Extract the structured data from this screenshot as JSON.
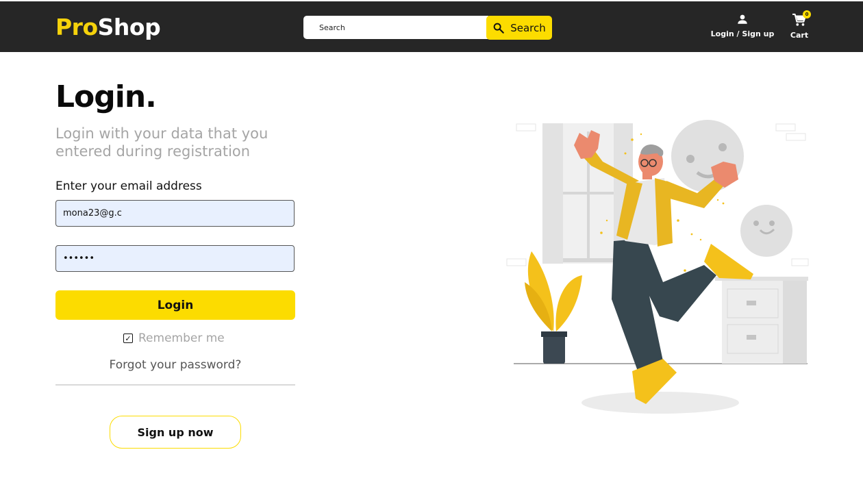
{
  "brand": {
    "part1": "Pro",
    "part2": "Shop"
  },
  "search": {
    "placeholder": "Search",
    "button_label": "Search"
  },
  "nav": {
    "login_label": "Login / Sign up",
    "cart_label": "Cart",
    "cart_count": "0"
  },
  "login": {
    "title": "Login.",
    "subtitle": "Login with your data that you entered during registration",
    "email_label": "Enter your email address",
    "email_value": "mona23@g.c",
    "password_value": "mmmmmm",
    "login_button": "Login",
    "remember_label": "Remember me",
    "remember_checked": true,
    "forgot_link": "Forgot your password?",
    "signup_button": "Sign up now"
  },
  "colors": {
    "accent": "#fcdc00",
    "header_bg": "#262626",
    "muted_text": "#a5a5a5"
  },
  "icons": {
    "search": "search-icon",
    "user": "user-icon",
    "cart": "cart-icon",
    "check": "checkmark-icon"
  }
}
